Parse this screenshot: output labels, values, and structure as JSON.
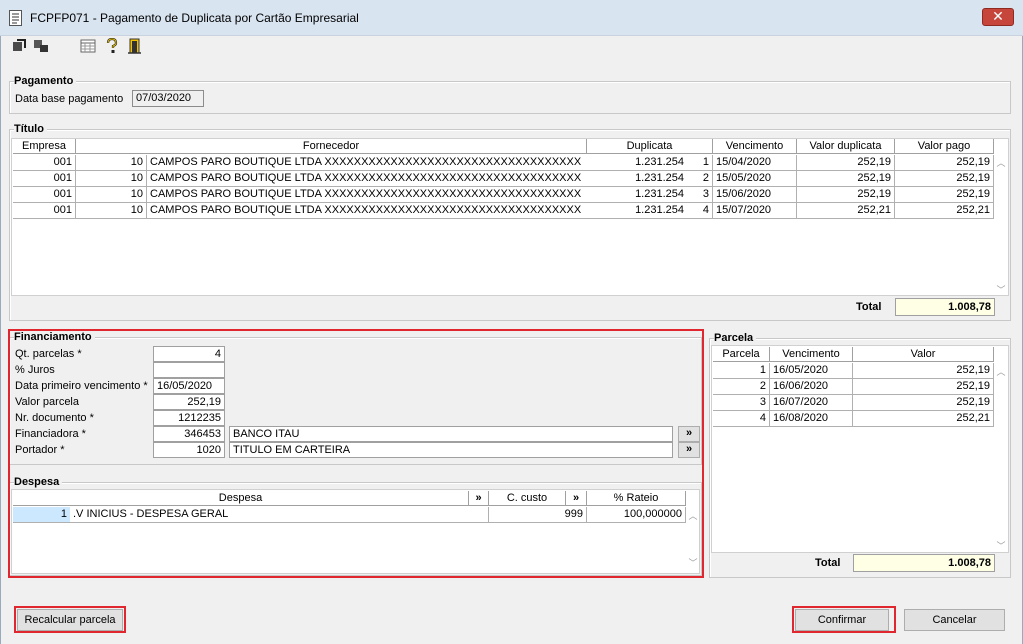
{
  "window": {
    "title": "FCPFP071 - Pagamento de Duplicata por Cartão Empresarial",
    "close_symbol": "✕"
  },
  "toolbar": {
    "icons": [
      "go-icon",
      "process-icon",
      "calendar-grid-icon",
      "help-icon",
      "exit-door-icon"
    ]
  },
  "pagamento": {
    "title": "Pagamento",
    "data_base_label": "Data base pagamento",
    "data_base_value": "07/03/2020"
  },
  "titulo": {
    "title": "Título",
    "columns": [
      "Empresa",
      "Fornecedor",
      "Duplicata",
      "Vencimento",
      "Valor duplicata",
      "Valor pago"
    ],
    "rows": [
      {
        "empresa": "001",
        "forn_cod": "10",
        "fornecedor": "CAMPOS PARO BOUTIQUE LTDA XXXXXXXXXXXXXXXXXXXXXXXXXXXXXXXXXXX",
        "duplicata": "1.231.254",
        "parcela": "1",
        "vencimento": "15/04/2020",
        "valor_duplicata": "252,19",
        "valor_pago": "252,19"
      },
      {
        "empresa": "001",
        "forn_cod": "10",
        "fornecedor": "CAMPOS PARO BOUTIQUE LTDA XXXXXXXXXXXXXXXXXXXXXXXXXXXXXXXXXXX",
        "duplicata": "1.231.254",
        "parcela": "2",
        "vencimento": "15/05/2020",
        "valor_duplicata": "252,19",
        "valor_pago": "252,19"
      },
      {
        "empresa": "001",
        "forn_cod": "10",
        "fornecedor": "CAMPOS PARO BOUTIQUE LTDA XXXXXXXXXXXXXXXXXXXXXXXXXXXXXXXXXXX",
        "duplicata": "1.231.254",
        "parcela": "3",
        "vencimento": "15/06/2020",
        "valor_duplicata": "252,19",
        "valor_pago": "252,19"
      },
      {
        "empresa": "001",
        "forn_cod": "10",
        "fornecedor": "CAMPOS PARO BOUTIQUE LTDA XXXXXXXXXXXXXXXXXXXXXXXXXXXXXXXXXXX",
        "duplicata": "1.231.254",
        "parcela": "4",
        "vencimento": "15/07/2020",
        "valor_duplicata": "252,21",
        "valor_pago": "252,21"
      }
    ],
    "total_label": "Total",
    "total_value": "1.008,78"
  },
  "financiamento": {
    "title": "Financiamento",
    "qt_parcelas_label": "Qt. parcelas *",
    "qt_parcelas_value": "4",
    "juros_label": "% Juros",
    "juros_value": "",
    "data_primeiro_label": "Data primeiro vencimento *",
    "data_primeiro_value": "16/05/2020",
    "valor_parcela_label": "Valor parcela",
    "valor_parcela_value": "252,19",
    "nr_documento_label": "Nr. documento *",
    "nr_documento_value": "1212235",
    "financiadora_label": "Financiadora *",
    "financiadora_code": "346453",
    "financiadora_name": "BANCO ITAU",
    "portador_label": "Portador *",
    "portador_code": "1020",
    "portador_name": "TITULO EM CARTEIRA",
    "lookup_symbol": "»"
  },
  "despesa": {
    "title": "Despesa",
    "columns": [
      "Despesa",
      "C. custo",
      "% Rateio"
    ],
    "header_button": "»",
    "rows": [
      {
        "code": "1",
        "name": ".V INICIUS - DESPESA GERAL",
        "c_custo": "999",
        "rateio": "100,000000"
      }
    ]
  },
  "parcela": {
    "title": "Parcela",
    "columns": [
      "Parcela",
      "Vencimento",
      "Valor"
    ],
    "rows": [
      {
        "parcela": "1",
        "vencimento": "16/05/2020",
        "valor": "252,19"
      },
      {
        "parcela": "2",
        "vencimento": "16/06/2020",
        "valor": "252,19"
      },
      {
        "parcela": "3",
        "vencimento": "16/07/2020",
        "valor": "252,19"
      },
      {
        "parcela": "4",
        "vencimento": "16/08/2020",
        "valor": "252,21"
      }
    ],
    "total_label": "Total",
    "total_value": "1.008,78"
  },
  "buttons": {
    "recalcular": "Recalcular parcela",
    "confirmar": "Confirmar",
    "cancelar": "Cancelar"
  },
  "colors": {
    "highlight_red": "#e0262f",
    "total_bg": "#ffffe6",
    "selection": "#cce8ff"
  }
}
